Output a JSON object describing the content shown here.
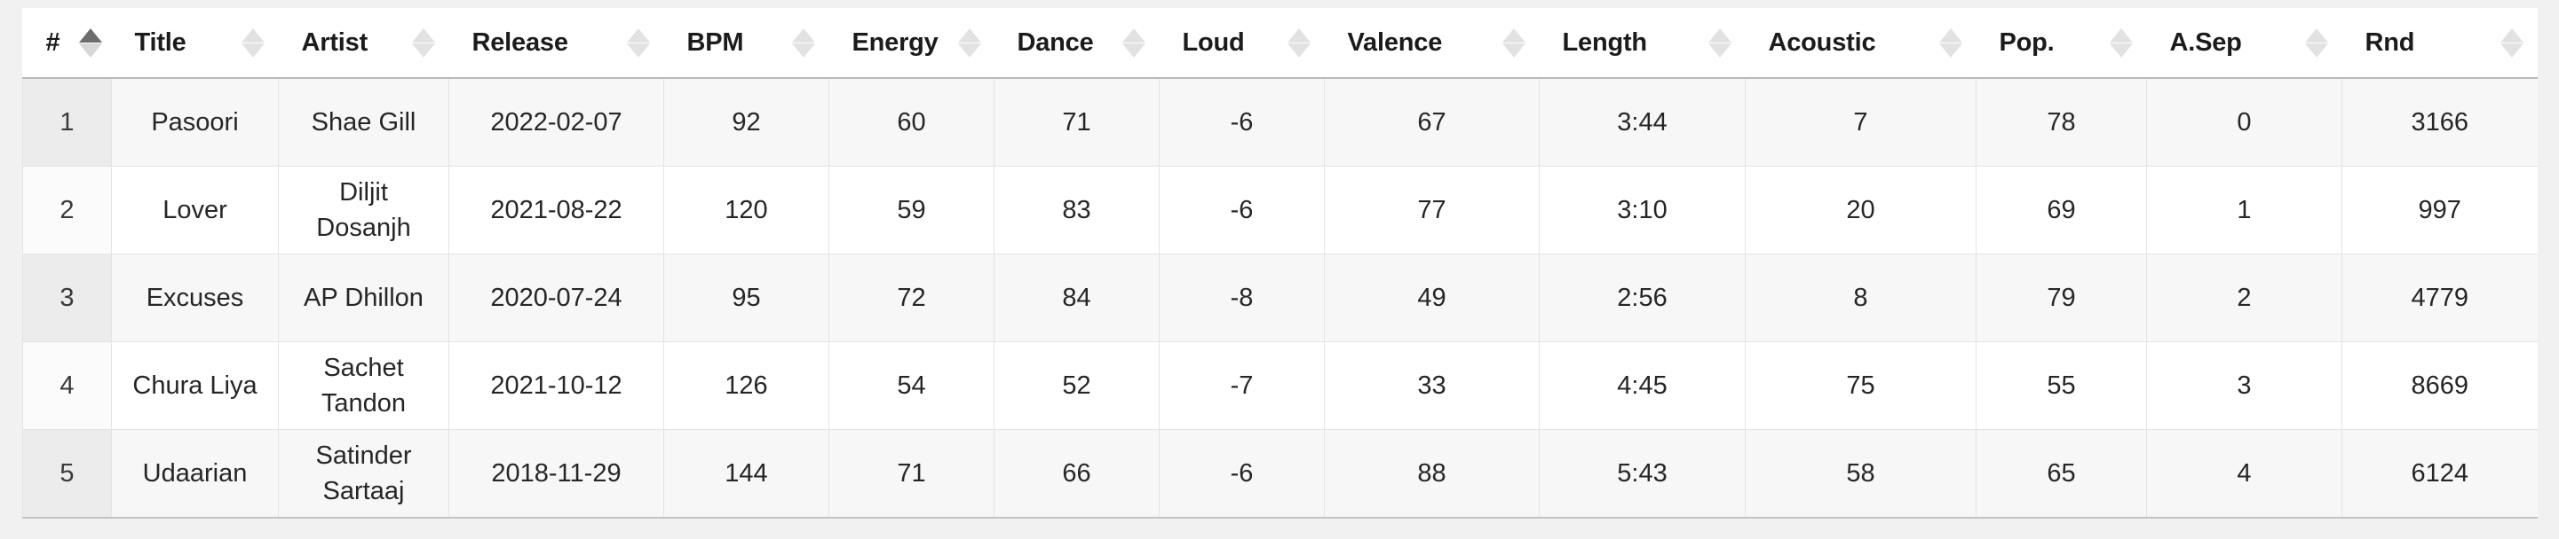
{
  "table": {
    "sort": {
      "column": "#",
      "direction": "asc"
    },
    "columns": [
      {
        "key": "index",
        "label": "#",
        "sort_icon": "sort-ascending-icon",
        "sorted": "asc"
      },
      {
        "key": "title",
        "label": "Title",
        "sort_icon": "sort-icon",
        "sorted": "none"
      },
      {
        "key": "artist",
        "label": "Artist",
        "sort_icon": "sort-icon",
        "sorted": "none"
      },
      {
        "key": "release",
        "label": "Release",
        "sort_icon": "sort-icon",
        "sorted": "none"
      },
      {
        "key": "bpm",
        "label": "BPM",
        "sort_icon": "sort-icon",
        "sorted": "none"
      },
      {
        "key": "energy",
        "label": "Energy",
        "sort_icon": "sort-icon",
        "sorted": "none"
      },
      {
        "key": "dance",
        "label": "Dance",
        "sort_icon": "sort-icon",
        "sorted": "none"
      },
      {
        "key": "loud",
        "label": "Loud",
        "sort_icon": "sort-icon",
        "sorted": "none"
      },
      {
        "key": "valence",
        "label": "Valence",
        "sort_icon": "sort-icon",
        "sorted": "none"
      },
      {
        "key": "length",
        "label": "Length",
        "sort_icon": "sort-icon",
        "sorted": "none"
      },
      {
        "key": "acoustic",
        "label": "Acoustic",
        "sort_icon": "sort-icon",
        "sorted": "none"
      },
      {
        "key": "pop",
        "label": "Pop.",
        "sort_icon": "sort-icon",
        "sorted": "none"
      },
      {
        "key": "asep",
        "label": "A.Sep",
        "sort_icon": "sort-icon",
        "sorted": "none"
      },
      {
        "key": "rnd",
        "label": "Rnd",
        "sort_icon": "sort-icon",
        "sorted": "none"
      }
    ],
    "rows": [
      {
        "index": "1",
        "title": "Pasoori",
        "artist": "Shae Gill",
        "release": "2022-02-07",
        "bpm": "92",
        "energy": "60",
        "dance": "71",
        "loud": "-6",
        "valence": "67",
        "length": "3:44",
        "acoustic": "7",
        "pop": "78",
        "asep": "0",
        "rnd": "3166"
      },
      {
        "index": "2",
        "title": "Lover",
        "artist": "Diljit Dosanjh",
        "release": "2021-08-22",
        "bpm": "120",
        "energy": "59",
        "dance": "83",
        "loud": "-6",
        "valence": "77",
        "length": "3:10",
        "acoustic": "20",
        "pop": "69",
        "asep": "1",
        "rnd": "997"
      },
      {
        "index": "3",
        "title": "Excuses",
        "artist": "AP Dhillon",
        "release": "2020-07-24",
        "bpm": "95",
        "energy": "72",
        "dance": "84",
        "loud": "-8",
        "valence": "49",
        "length": "2:56",
        "acoustic": "8",
        "pop": "79",
        "asep": "2",
        "rnd": "4779"
      },
      {
        "index": "4",
        "title": "Chura Liya",
        "artist": "Sachet Tandon",
        "release": "2021-10-12",
        "bpm": "126",
        "energy": "54",
        "dance": "52",
        "loud": "-7",
        "valence": "33",
        "length": "4:45",
        "acoustic": "75",
        "pop": "55",
        "asep": "3",
        "rnd": "8669"
      },
      {
        "index": "5",
        "title": "Udaarian",
        "artist": "Satinder Sartaaj",
        "release": "2018-11-29",
        "bpm": "144",
        "energy": "71",
        "dance": "66",
        "loud": "-6",
        "valence": "88",
        "length": "5:43",
        "acoustic": "58",
        "pop": "65",
        "asep": "4",
        "rnd": "6124"
      }
    ]
  },
  "colors": {
    "page_background": "#f1f1f1",
    "table_background": "#ffffff",
    "stripe_background": "#f7f7f7",
    "index_stripe_background": "#ececec",
    "border": "#e4e4e4",
    "header_rule": "#b9b9b9",
    "header_text": "#1b1b1b",
    "cell_text": "#262626",
    "sort_inactive": "#e2e2e2",
    "sort_active": "#6d6d6d"
  }
}
